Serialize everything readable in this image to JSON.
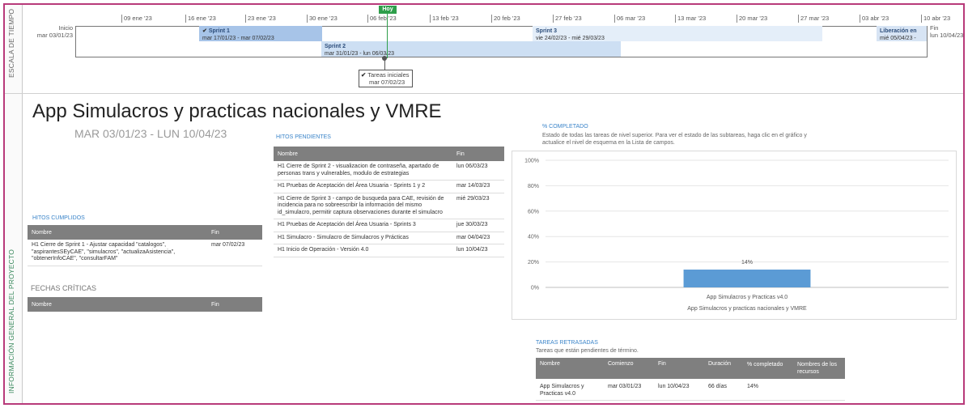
{
  "side_labels": {
    "timescale": "ESCALA DE TIEMPO",
    "project_info": "INFORMACIÓN GENERAL DEL PROYECTO"
  },
  "timeline": {
    "ticks": [
      "09 ene '23",
      "16 ene '23",
      "23 ene '23",
      "30 ene '23",
      "06 feb '23",
      "13 feb '23",
      "20 feb '23",
      "27 feb '23",
      "06 mar '23",
      "13 mar '23",
      "20 mar '23",
      "27 mar '23",
      "03 abr '23",
      "10 abr '23"
    ],
    "start": {
      "label": "Inicio",
      "date": "mar 03/01/23"
    },
    "finish": {
      "label": "Fin",
      "date": "lun 10/04/23"
    },
    "today_label": "Hoy",
    "bars": {
      "sprint1": {
        "name": "Sprint 1",
        "dates": "mar 17/01/23 - mar 07/02/23"
      },
      "sprint2": {
        "name": "Sprint 2",
        "dates": "mar 31/01/23 - lun 06/03/23"
      },
      "sprint3": {
        "name": "Sprint 3",
        "dates": "vie 24/02/23 - mié 29/03/23"
      },
      "liberacion": {
        "name": "Liberación en",
        "dates": "mié 05/04/23 -"
      }
    },
    "milestone": {
      "name": "Tareas iniciales",
      "date": "mar 07/02/23"
    }
  },
  "project": {
    "title": "App Simulacros y practicas nacionales y VMRE",
    "dates": "MAR 03/01/23 - LUN 10/04/23"
  },
  "hitos_cumplidos": {
    "title": "HITOS CUMPLIDOS",
    "headers": [
      "Nombre",
      "Fin"
    ],
    "rows": [
      {
        "name": "H1 Cierre de Sprint 1 - Ajustar capacidad \"catalogos\", \"aspirantesSEyCAE\", \"simulacros\", \"actualizaAsistencia\", \"obtenerInfoCAE\", \"consultarFAM\"",
        "fin": "mar 07/02/23"
      }
    ]
  },
  "fechas_criticas": {
    "title": "FECHAS CRÍTICAS",
    "headers": [
      "Nombre",
      "Fin"
    ]
  },
  "hitos_pendientes": {
    "title": "HITOS PENDIENTES",
    "headers": [
      "Nombre",
      "Fin"
    ],
    "rows": [
      {
        "name": "H1 Cierre de Sprint 2 - visualizacion de contraseña, apartado de personas trans y vulnerables, modulo de estrategias",
        "fin": "lun 06/03/23"
      },
      {
        "name": "H1 Pruebas de Aceptación del Área Usuaria - Sprints 1 y 2",
        "fin": "mar 14/03/23"
      },
      {
        "name": "H1 Cierre de Sprint 3 - campo de busqueda para CAE, revisión de incidencia para no sobreescribir la información del mismo id_simulacro, permitir captura observaciones durante el simulacro",
        "fin": "mié 29/03/23"
      },
      {
        "name": "H1 Pruebas de Aceptación del Área Usuaria - Sprints 3",
        "fin": "jue 30/03/23"
      },
      {
        "name": "H1 Simulacro - Simulacro de Simulacros y Prácticas",
        "fin": "mar 04/04/23"
      },
      {
        "name": "H1 Inicio de Operación - Versión 4.0",
        "fin": "lun 10/04/23"
      }
    ]
  },
  "completion": {
    "title": "% COMPLETADO",
    "subtitle": "Estado de todas las tareas de nivel superior. Para ver el estado de las subtareas, haga clic en el gráfico y actualice el nivel de esquema en la Lista de campos."
  },
  "chart_data": {
    "type": "bar",
    "categories": [
      "App Simulacros y Practicas v4.0"
    ],
    "values": [
      14
    ],
    "data_labels": [
      "14%"
    ],
    "y_ticks": [
      "0%",
      "20%",
      "40%",
      "60%",
      "80%",
      "100%"
    ],
    "ylim": [
      0,
      100
    ],
    "xlabel": "App Simulacros y practicas nacionales y VMRE",
    "bar_color": "#5b9bd5",
    "grid": true
  },
  "tareas_retrasadas": {
    "title": "TAREAS RETRASADAS",
    "subtitle": "Tareas que están pendientes de término.",
    "headers": [
      "Nombre",
      "Comienzo",
      "Fin",
      "Duración",
      "% completado",
      "Nombres de los recursos"
    ],
    "rows": [
      {
        "nombre": "App Simulacros y Practicas v4.0",
        "comienzo": "mar 03/01/23",
        "fin": "lun 10/04/23",
        "duracion": "66 días",
        "completado": "14%",
        "recursos": ""
      }
    ]
  },
  "colors": {
    "frame": "#b83a7a",
    "today": "#2e9e4a",
    "accent": "#3a84c9"
  }
}
